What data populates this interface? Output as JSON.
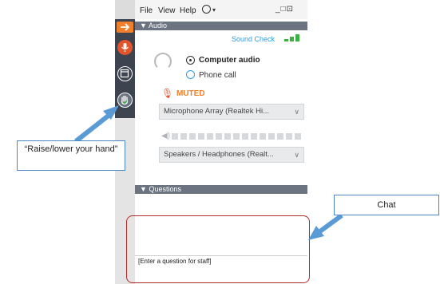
{
  "menubar": {
    "items": [
      "File",
      "View",
      "Help"
    ],
    "window_controls": "_□⊡"
  },
  "audio": {
    "header": "Audio",
    "sound_check": "Sound Check",
    "options": [
      {
        "label": "Computer audio",
        "selected": true
      },
      {
        "label": "Phone call",
        "selected": false
      }
    ],
    "mic_status": "MUTED",
    "microphone_device": "Microphone Array (Realtek Hi...",
    "speaker_device": "Speakers / Headphones (Realt..."
  },
  "questions": {
    "header": "Questions",
    "input_placeholder": "[Enter a question for staff]"
  },
  "callouts": {
    "raise_hand": "“Raise/lower your hand”",
    "chat": "Chat"
  },
  "colors": {
    "toolbar": "#3d4450",
    "accent_orange": "#f07f2b",
    "mic_red": "#e4532a",
    "section_header": "#6b7480",
    "link_blue": "#2f9be0",
    "signal_green": "#3cb043",
    "highlight_red": "#b22a2a",
    "callout_arrow": "#5b9bd5"
  }
}
